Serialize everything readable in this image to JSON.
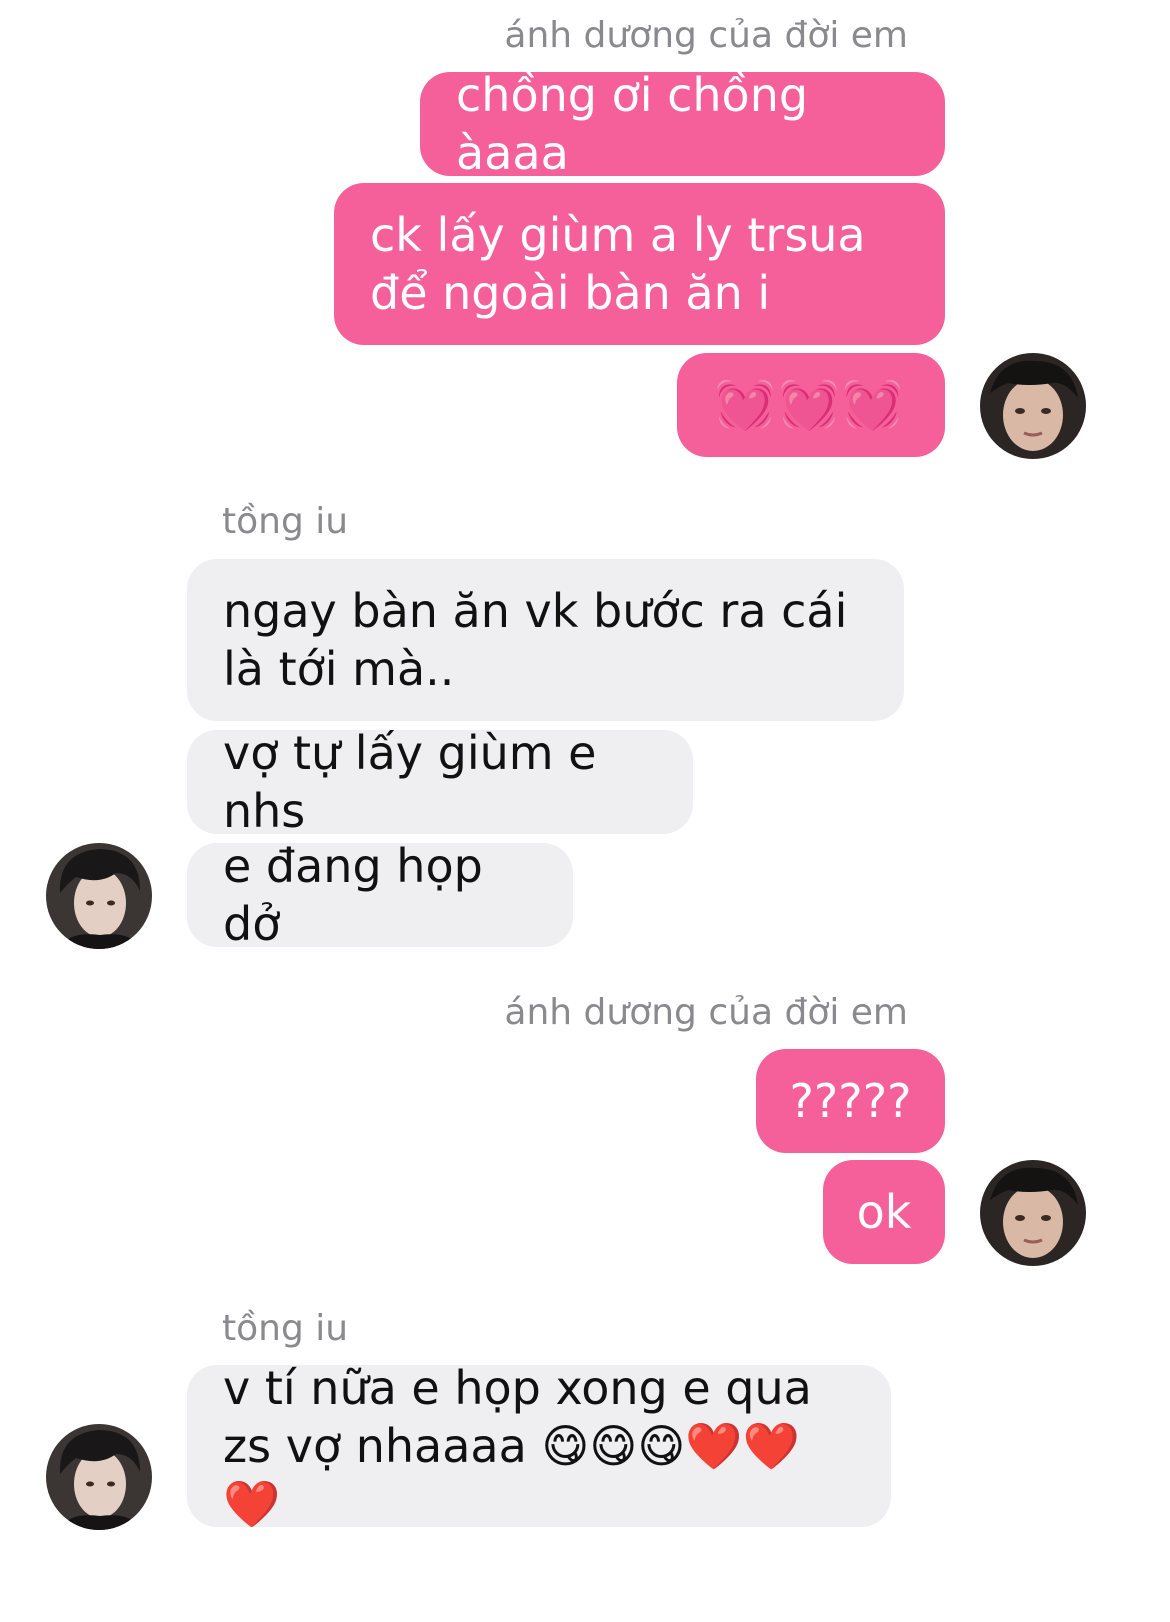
{
  "conversation": {
    "groups": [
      {
        "sender": "ánh dương của đời em",
        "messages": [
          "chồng ơi chồng àaaa",
          "ck lấy giùm a ly trsua để ngoài bàn ăn i",
          "💓💓💓"
        ]
      },
      {
        "sender": "tồng iu",
        "messages": [
          "ngay bàn ăn vk bước ra cái là tới mà..",
          "vợ tự lấy giùm e nhs",
          "e đang họp dở"
        ]
      },
      {
        "sender": "ánh dương của đời em",
        "messages": [
          "?????",
          "ok"
        ]
      },
      {
        "sender": "tồng iu",
        "messages": [
          "v tí nữa e họp xong e qua zs vợ nhaaaa 😋😋😋❤️❤️❤️"
        ]
      }
    ]
  },
  "icons": {
    "avatar_self": "avatar-self-photo",
    "avatar_other": "avatar-other-photo"
  },
  "colors": {
    "outgoing_bubble": "#f6609a",
    "incoming_bubble": "#efeff1",
    "sender_label": "#8a8a8e"
  }
}
